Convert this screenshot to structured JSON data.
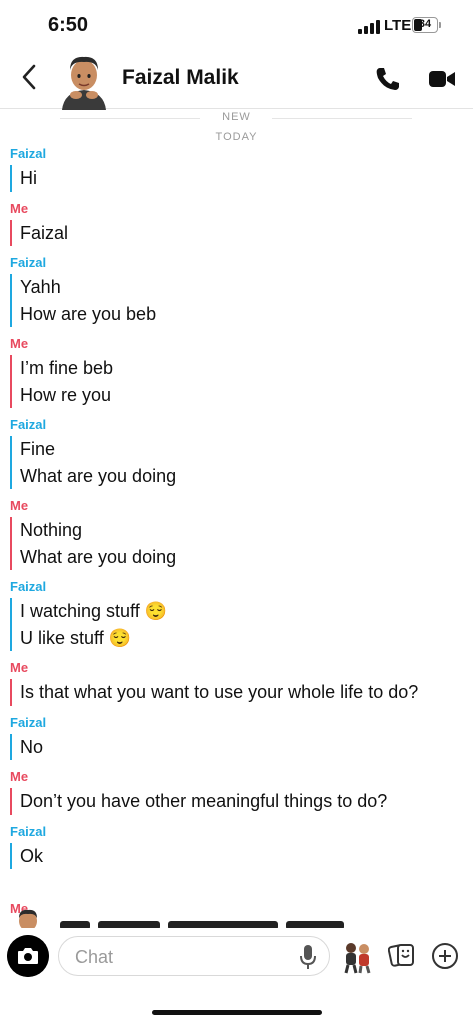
{
  "status_bar": {
    "time": "6:50",
    "network": "LTE",
    "battery": "34"
  },
  "header": {
    "contact_name": "Faizal Malik"
  },
  "dividers": {
    "new_label": "NEW",
    "today_label": "TODAY"
  },
  "messages": [
    {
      "sender": "Faizal",
      "lines": [
        "Hi"
      ]
    },
    {
      "sender": "Me",
      "lines": [
        "Faizal"
      ]
    },
    {
      "sender": "Faizal",
      "lines": [
        "Yahh",
        "How are you beb"
      ]
    },
    {
      "sender": "Me",
      "lines": [
        "I’m fine beb",
        "How re you"
      ]
    },
    {
      "sender": "Faizal",
      "lines": [
        "Fine",
        "What are you doing"
      ]
    },
    {
      "sender": "Me",
      "lines": [
        "Nothing",
        "What are you doing"
      ]
    },
    {
      "sender": "Faizal",
      "lines": [
        "I watching stuff 😌",
        "U like stuff 😌"
      ]
    },
    {
      "sender": "Me",
      "lines": [
        "Is that what you want to use your whole life to do?"
      ]
    },
    {
      "sender": "Faizal",
      "lines": [
        "No"
      ]
    },
    {
      "sender": "Me",
      "lines": [
        "Don’t you have other meaningful things to do?"
      ]
    },
    {
      "sender": "Faizal",
      "lines": [
        "Ok"
      ]
    }
  ],
  "peek_sender": "Me",
  "composer": {
    "placeholder": "Chat"
  },
  "icons": {
    "back": "chevron-left-icon",
    "call": "phone-icon",
    "video": "video-camera-icon",
    "camera": "camera-icon",
    "mic": "microphone-icon",
    "bitmoji": "bitmoji-icon",
    "cards": "sticker-cards-icon",
    "plus": "plus-circle-icon"
  },
  "colors": {
    "friend": "#1ea8e0",
    "me": "#e84a5f"
  }
}
